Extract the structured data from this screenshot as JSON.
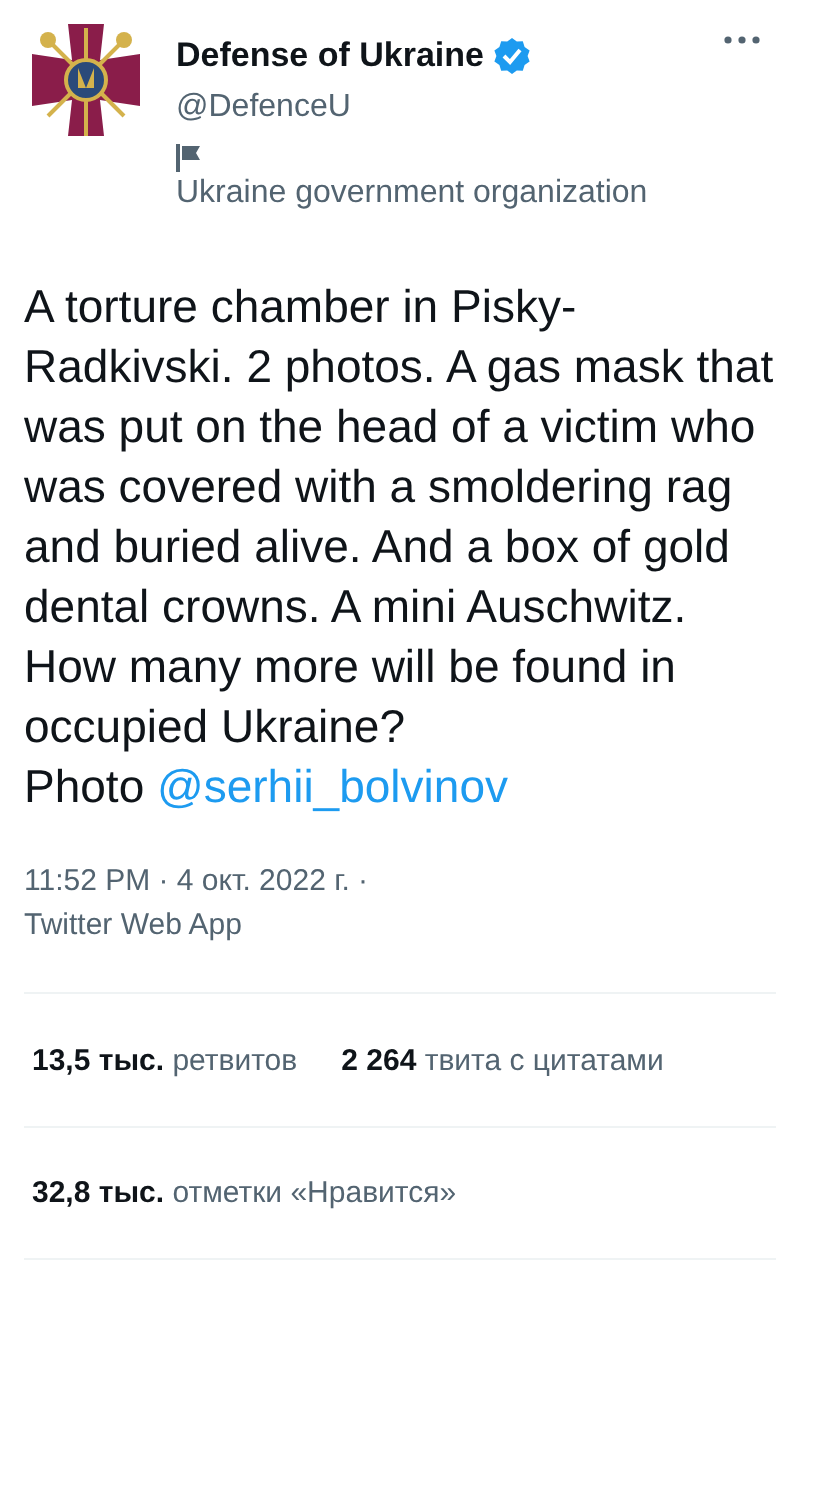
{
  "author": {
    "name": "Defense of Ukraine",
    "verified": true,
    "handle": "@DefenceU",
    "label": "Ukraine government organization"
  },
  "tweet": {
    "text": "A torture chamber in Pisky-Radkivski. 2 photos. A gas mask that was put on the head of a victim who was covered with a smoldering rag and buried alive. And a box of gold dental crowns. A mini Auschwitz. How many more will be found in occupied Ukraine?",
    "credit": "Photo",
    "link": "@serhii_bolvinov"
  },
  "meta": {
    "time": "11:52 PM · 4 окт. 2022 г. ·",
    "source": "Twitter Web App"
  },
  "stat_rows": [
    [
      {
        "count": "13,5 тыс.",
        "label": "ретвитов"
      },
      {
        "count": "2 264",
        "label": "твита с цитатами"
      }
    ],
    [
      {
        "count": "32,8 тыс.",
        "label": "отметки «Нравится»"
      }
    ]
  ]
}
